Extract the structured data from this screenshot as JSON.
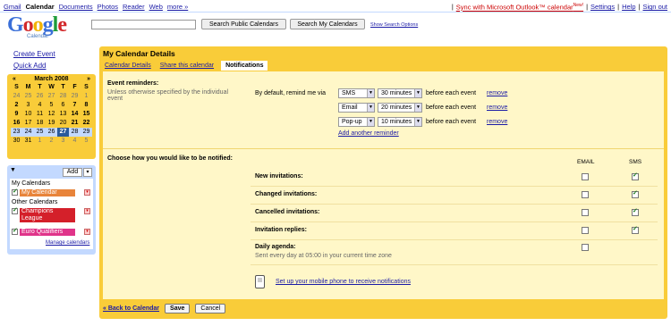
{
  "topnav": [
    "Gmail",
    "Calendar",
    "Documents",
    "Photos",
    "Reader",
    "Web",
    "more »"
  ],
  "toplinks": {
    "sync": "Sync with Microsoft Outlook™ calendar",
    "new": "New!",
    "settings": "Settings",
    "help": "Help",
    "signout": "Sign out"
  },
  "logo": {
    "text": "Google",
    "sub": "Calendar"
  },
  "search": {
    "public": "Search Public Calendars",
    "mine": "Search My Calendars",
    "options": "Show Search Options"
  },
  "left": {
    "create": "Create Event",
    "quickadd": "Quick Add",
    "minical": {
      "month": "March 2008",
      "prev": "«",
      "next": "»",
      "dow": [
        "S",
        "M",
        "T",
        "W",
        "T",
        "F",
        "S"
      ],
      "weeks": [
        [
          "24",
          "25",
          "26",
          "27",
          "28",
          "29",
          "1"
        ],
        [
          "2",
          "3",
          "4",
          "5",
          "6",
          "7",
          "8"
        ],
        [
          "9",
          "10",
          "11",
          "12",
          "13",
          "14",
          "15"
        ],
        [
          "16",
          "17",
          "18",
          "19",
          "20",
          "21",
          "22"
        ],
        [
          "23",
          "24",
          "25",
          "26",
          "27",
          "28",
          "29"
        ],
        [
          "30",
          "31",
          "1",
          "2",
          "3",
          "4",
          "5"
        ]
      ]
    },
    "calendars": {
      "add": "Add",
      "my_title": "My Calendars",
      "my": [
        {
          "name": "My Calendar",
          "color": "#e8843a"
        }
      ],
      "other_title": "Other Calendars",
      "other": [
        {
          "name": "Champions League",
          "color": "#d4202a"
        },
        {
          "name": "Euro Qualifiers",
          "color": "#e0348a"
        }
      ],
      "manage": "Manage calendars"
    }
  },
  "main": {
    "title": "My Calendar Details",
    "tabs": [
      "Calendar Details",
      "Share this calendar",
      "Notifications"
    ],
    "reminders": {
      "label": "Event reminders:",
      "hint": "Unless otherwise specified by the individual event",
      "default": "By default, remind me via",
      "rows": [
        {
          "method": "SMS",
          "time": "30 minutes",
          "suffix": "before each event",
          "remove": "remove"
        },
        {
          "method": "Email",
          "time": "20 minutes",
          "suffix": "before each event",
          "remove": "remove"
        },
        {
          "method": "Pop-up",
          "time": "10 minutes",
          "suffix": "before each event",
          "remove": "remove"
        }
      ],
      "add": "Add another reminder"
    },
    "notify": {
      "label": "Choose how you would like to be notified:",
      "col_email": "EMAIL",
      "col_sms": "SMS",
      "rows": [
        {
          "name": "New invitations:",
          "email": false,
          "sms": true
        },
        {
          "name": "Changed invitations:",
          "email": false,
          "sms": true
        },
        {
          "name": "Cancelled invitations:",
          "email": false,
          "sms": true
        },
        {
          "name": "Invitation replies:",
          "email": false,
          "sms": true
        },
        {
          "name": "Daily agenda:",
          "sub": "Sent every day at 05:00 in your current time zone",
          "email": false
        }
      ],
      "mobile": "Set up your mobile phone to receive notifications"
    },
    "bottom": {
      "back": "« Back to Calendar",
      "save": "Save",
      "cancel": "Cancel"
    }
  }
}
